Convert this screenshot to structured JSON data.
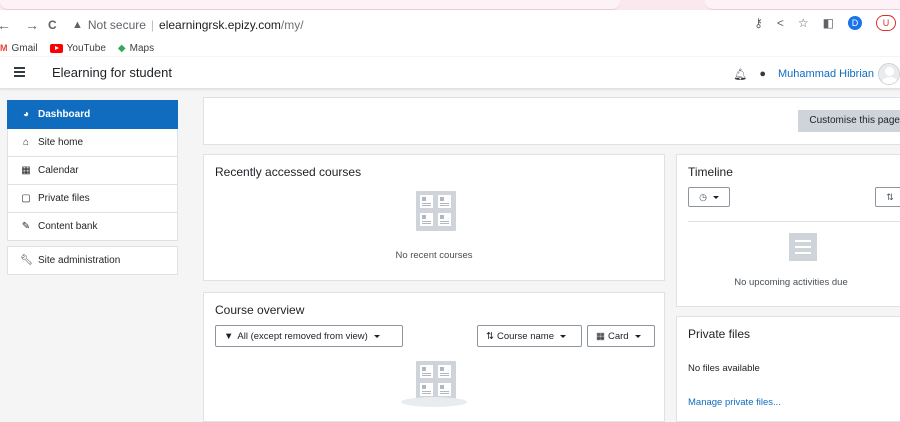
{
  "browser": {
    "nav": {
      "back": "←",
      "forward": "→",
      "reload": "C"
    },
    "url": {
      "security_label": "Not secure",
      "host": "elearningrsk.epizy.com",
      "path": "/my/"
    },
    "profile_initial_d": "D",
    "profile_initial_u": "U",
    "bookmarks": [
      "Gmail",
      "YouTube",
      "Maps"
    ]
  },
  "navbar": {
    "site_name": "Elearning for student",
    "user_name": "Muhammad Hibrian"
  },
  "sidebar": {
    "items": [
      {
        "label": "Dashboard",
        "icon": "tachometer-icon"
      },
      {
        "label": "Site home",
        "icon": "home-icon"
      },
      {
        "label": "Calendar",
        "icon": "calendar-icon"
      },
      {
        "label": "Private files",
        "icon": "file-icon"
      },
      {
        "label": "Content bank",
        "icon": "paint-brush-icon"
      }
    ],
    "admin": {
      "label": "Site administration",
      "icon": "wrench-icon"
    }
  },
  "header": {
    "customise_label": "Customise this page"
  },
  "recent": {
    "title": "Recently accessed courses",
    "empty": "No recent courses"
  },
  "overview": {
    "title": "Course overview",
    "filter": "All (except removed from view)",
    "sort": "Course name",
    "view": "Card"
  },
  "timeline": {
    "title": "Timeline",
    "empty": "No upcoming activities due"
  },
  "private_files": {
    "title": "Private files",
    "empty": "No files available",
    "manage": "Manage private files..."
  },
  "colors": {
    "primary": "#0f6cbf",
    "button_grey": "#ced4da"
  }
}
